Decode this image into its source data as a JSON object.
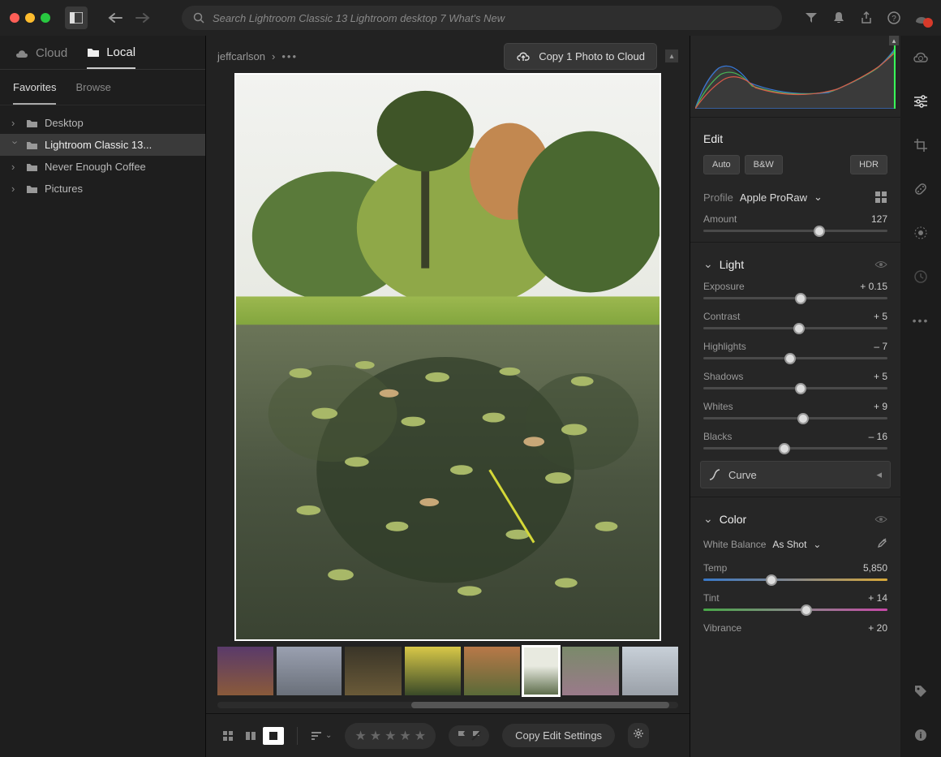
{
  "search": {
    "placeholder": "Search Lightroom Classic 13 Lightroom desktop 7 What's New"
  },
  "source_tabs": {
    "cloud": "Cloud",
    "local": "Local"
  },
  "sub_tabs": {
    "favorites": "Favorites",
    "browse": "Browse"
  },
  "folders": [
    {
      "name": "Desktop",
      "expanded": false,
      "selected": false
    },
    {
      "name": "Lightroom Classic 13...",
      "expanded": true,
      "selected": true
    },
    {
      "name": "Never Enough Coffee",
      "expanded": false,
      "selected": false
    },
    {
      "name": "Pictures",
      "expanded": false,
      "selected": false
    }
  ],
  "breadcrumb": {
    "user": "jeffcarlson"
  },
  "cloud_button": "Copy 1 Photo to Cloud",
  "footer": {
    "copy_edit": "Copy Edit Settings"
  },
  "edit": {
    "title": "Edit",
    "auto": "Auto",
    "bw": "B&W",
    "hdr": "HDR",
    "profile_label": "Profile",
    "profile_value": "Apple ProRaw",
    "amount_label": "Amount",
    "amount_value": "127",
    "light": {
      "title": "Light",
      "exposure": {
        "label": "Exposure",
        "value": "+ 0.15",
        "pos": 53
      },
      "contrast": {
        "label": "Contrast",
        "value": "+ 5",
        "pos": 52
      },
      "highlights": {
        "label": "Highlights",
        "value": "– 7",
        "pos": 47
      },
      "shadows": {
        "label": "Shadows",
        "value": "+ 5",
        "pos": 53
      },
      "whites": {
        "label": "Whites",
        "value": "+ 9",
        "pos": 54
      },
      "blacks": {
        "label": "Blacks",
        "value": "– 16",
        "pos": 44
      }
    },
    "curve": "Curve",
    "color": {
      "title": "Color",
      "wb_label": "White Balance",
      "wb_value": "As Shot",
      "temp": {
        "label": "Temp",
        "value": "5,850",
        "pos": 37
      },
      "tint": {
        "label": "Tint",
        "value": "+ 14",
        "pos": 56
      },
      "vibrance": {
        "label": "Vibrance",
        "value": "+ 20"
      }
    }
  }
}
